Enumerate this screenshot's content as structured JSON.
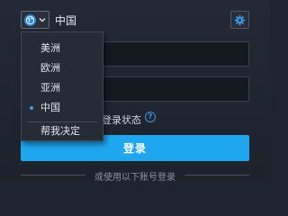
{
  "header": {
    "region_selected": "中国"
  },
  "region_menu": {
    "items": [
      "美洲",
      "欧洲",
      "亚洲",
      "中国"
    ],
    "selected_index": 3,
    "footer_item": "帮我决定"
  },
  "form": {
    "account_value": "",
    "password_value": "",
    "remember_label": "登录状态",
    "login_label": "登录",
    "other_login_label": "或使用以下账号登录"
  },
  "colors": {
    "accent": "#1ea7ef",
    "background": "#1f2530"
  },
  "icons": {
    "region": "globe-icon",
    "dropdown": "chevron-down-icon",
    "settings": "gear-icon",
    "help": "help-circle-icon"
  }
}
